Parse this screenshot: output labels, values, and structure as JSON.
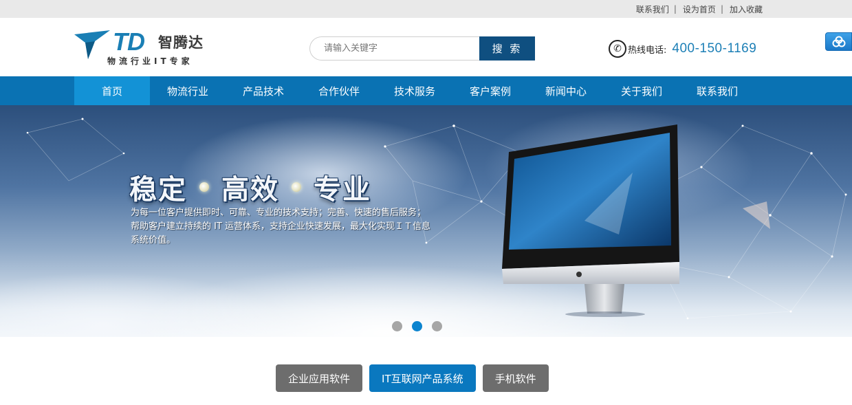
{
  "topbar": {
    "links": [
      "联系我们",
      "设为首页",
      "加入收藏"
    ],
    "separator": "|"
  },
  "logo": {
    "mark": "TD",
    "brand": "智腾达",
    "tagline": "物流行业IT专家"
  },
  "search": {
    "placeholder": "请输入关键字",
    "button_label": "搜 索"
  },
  "hotline": {
    "label": "热线电话:",
    "number": "400-150-1169",
    "icon": "phone-icon"
  },
  "side_share": {
    "icon": "share-cloud-icon"
  },
  "nav": {
    "items": [
      {
        "label": "首页",
        "active": true
      },
      {
        "label": "物流行业",
        "active": false
      },
      {
        "label": "产品技术",
        "active": false
      },
      {
        "label": "合作伙伴",
        "active": false
      },
      {
        "label": "技术服务",
        "active": false
      },
      {
        "label": "客户案例",
        "active": false
      },
      {
        "label": "新闻中心",
        "active": false
      },
      {
        "label": "关于我们",
        "active": false
      },
      {
        "label": "联系我们",
        "active": false
      }
    ]
  },
  "banner": {
    "slogan": [
      "稳定",
      "高效",
      "专业"
    ],
    "description": "为每一位客户提供即时、可靠、专业的技术支持；完善、快速的售后服务；帮助客户建立持续的 IT 运营体系，支持企业快速发展，最大化实现ＩＴ信息系统价值。",
    "slides": 3,
    "active_slide": 2
  },
  "tabs": [
    {
      "label": "企业应用软件",
      "active": false
    },
    {
      "label": "IT互联网产品系统",
      "active": true
    },
    {
      "label": "手机软件",
      "active": false
    }
  ],
  "colors": {
    "nav_bg": "#0a72b3",
    "nav_active": "#1392d6",
    "search_button": "#0f4f80",
    "hotline_number": "#1c7fb6",
    "tab_active": "#0a78bf",
    "tab_inactive": "#6d6d6d"
  }
}
